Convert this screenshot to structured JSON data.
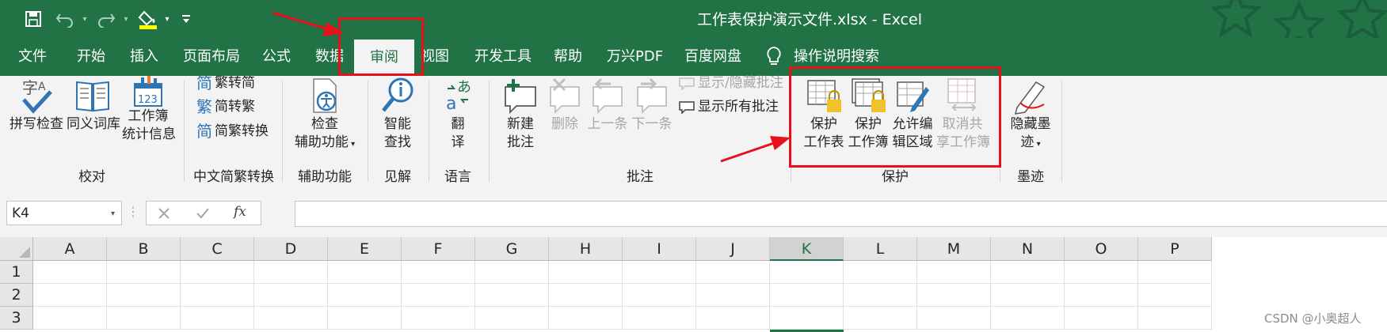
{
  "window": {
    "title": "工作表保护演示文件.xlsx  -  Excel"
  },
  "qat": {
    "save": "save-icon",
    "undo": "undo-icon",
    "redo": "redo-icon",
    "fill": "fill-color-icon",
    "customize": "customize-qat-icon"
  },
  "tabs": [
    {
      "label": "文件"
    },
    {
      "label": "开始"
    },
    {
      "label": "插入"
    },
    {
      "label": "页面布局"
    },
    {
      "label": "公式"
    },
    {
      "label": "数据"
    },
    {
      "label": "审阅"
    },
    {
      "label": "视图"
    },
    {
      "label": "开发工具"
    },
    {
      "label": "帮助"
    },
    {
      "label": "万兴PDF"
    },
    {
      "label": "百度网盘"
    }
  ],
  "tell_me": {
    "label": "操作说明搜索"
  },
  "ribbon": {
    "proofing": {
      "label": "校对",
      "spell": "拼写检查",
      "thesaurus": "同义词库",
      "stats_1": "工作簿",
      "stats_2": "统计信息"
    },
    "chinese": {
      "label": "中文简繁转换",
      "to_trad": "繁转简",
      "to_simp": "简转繁",
      "convert": "简繁转换",
      "icon_1": "简",
      "icon_2": "繁",
      "icon_3": "简"
    },
    "accessibility": {
      "label": "辅助功能",
      "btn_1": "检查",
      "btn_2": "辅助功能"
    },
    "insights": {
      "label": "见解",
      "btn_1": "智能",
      "btn_2": "查找"
    },
    "language": {
      "label": "语言",
      "btn_1": "翻",
      "btn_2": "译"
    },
    "comments": {
      "label": "批注",
      "new_1": "新建",
      "new_2": "批注",
      "delete": "删除",
      "prev": "上一条",
      "next": "下一条",
      "show_hide": "显示/隐藏批注",
      "show_all": "显示所有批注"
    },
    "protect": {
      "label": "保护",
      "sheet_1": "保护",
      "sheet_2": "工作表",
      "book_1": "保护",
      "book_2": "工作簿",
      "allow_1": "允许编",
      "allow_2": "辑区域",
      "unshare_1": "取消共",
      "unshare_2": "享工作簿"
    },
    "ink": {
      "label": "墨迹",
      "btn_1": "隐藏墨",
      "btn_2": "迹"
    }
  },
  "formula_bar": {
    "name_box": "K4",
    "fx": "fx",
    "value": ""
  },
  "sheet": {
    "columns": [
      "A",
      "B",
      "C",
      "D",
      "E",
      "F",
      "G",
      "H",
      "I",
      "J",
      "K",
      "L",
      "M",
      "N",
      "O",
      "P"
    ],
    "rows": [
      "1",
      "2",
      "3"
    ],
    "selected_column": "K"
  },
  "watermark": "CSDN @小奥超人",
  "colors": {
    "excel_green": "#217346",
    "annotation_red": "#e8101b"
  }
}
